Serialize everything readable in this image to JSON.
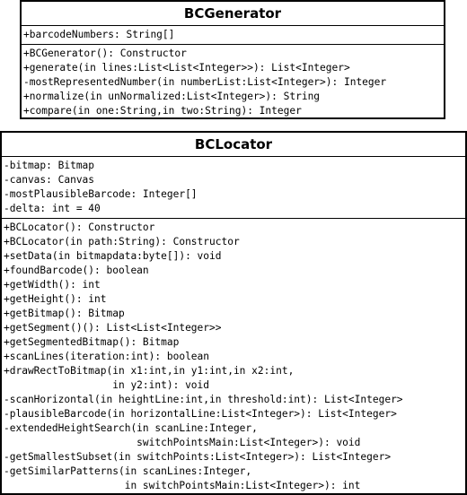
{
  "classes": [
    {
      "name": "BCGenerator",
      "attributes": [
        "+barcodeNumbers: String[]"
      ],
      "operations": [
        "+BCGenerator(): Constructor",
        "+generate(in lines:List<List<Integer>>): List<Integer>",
        "-mostRepresentedNumber(in numberList:List<Integer>): Integer",
        "+normalize(in unNormalized:List<Integer>): String",
        "+compare(in one:String,in two:String): Integer"
      ]
    },
    {
      "name": "BCLocator",
      "attributes": [
        "-bitmap: Bitmap",
        "-canvas: Canvas",
        "-mostPlausibleBarcode: Integer[]",
        "-delta: int = 40"
      ],
      "operations": [
        "+BCLocator(): Constructor",
        "+BCLocator(in path:String): Constructor",
        "+setData(in bitmapdata:byte[]): void",
        "+foundBarcode(): boolean",
        "+getWidth(): int",
        "+getHeight(): int",
        "+getBitmap(): Bitmap",
        "+getSegment()(): List<List<Integer>>",
        "+getSegmentedBitmap(): Bitmap",
        "+scanLines(iteration:int): boolean",
        "+drawRectToBitmap(in x1:int,in y1:int,in x2:int,",
        "                  in y2:int): void",
        "-scanHorizontal(in heightLine:int,in threshold:int): List<Integer>",
        "-plausibleBarcode(in horizontalLine:List<Integer>): List<Integer>",
        "-extendedHeightSearch(in scanLine:Integer,",
        "                      switchPointsMain:List<Integer>): void",
        "-getSmallestSubset(in switchPoints:List<Integer>): List<Integer>",
        "-getSimilarPatterns(in scanLines:Integer,",
        "                    in switchPointsMain:List<Integer>): int"
      ]
    }
  ]
}
